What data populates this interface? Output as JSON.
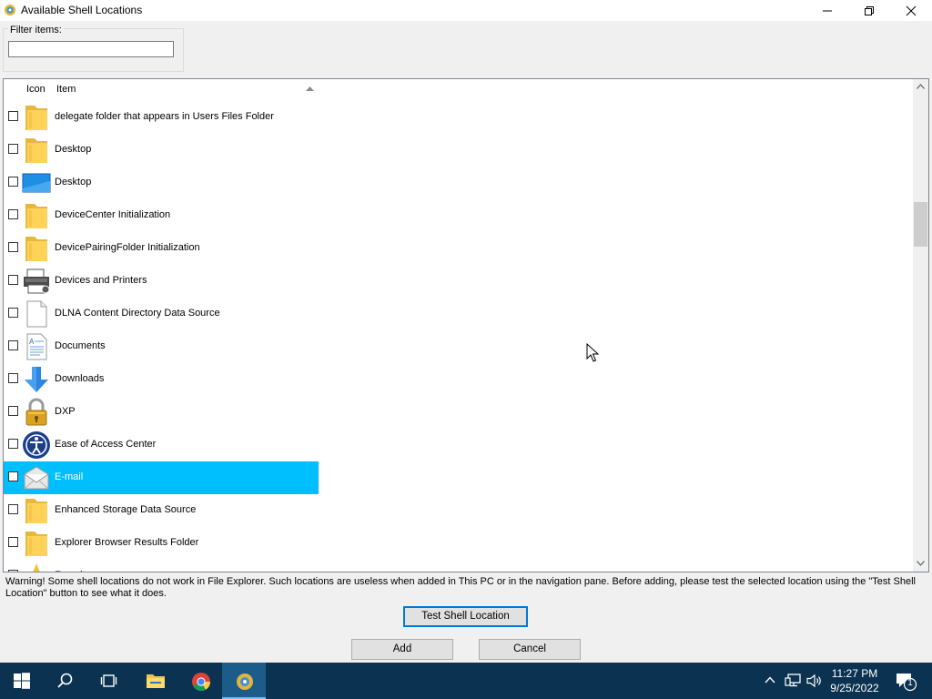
{
  "window": {
    "title": "Available Shell Locations",
    "colors": {
      "selection": "#00bfff",
      "taskbar": "#0b3250",
      "focus_border": "#0078d7"
    }
  },
  "filter": {
    "label": "Filter items:",
    "value": "",
    "placeholder": ""
  },
  "list": {
    "columns": {
      "icon": "Icon",
      "item": "Item"
    },
    "sort": "ascending",
    "items": [
      {
        "label": "delegate folder that appears in Users Files Folder",
        "icon": "folder-icon",
        "checked": false,
        "selected": false
      },
      {
        "label": "Desktop",
        "icon": "folder-icon",
        "checked": false,
        "selected": false
      },
      {
        "label": "Desktop",
        "icon": "desktop-icon",
        "checked": false,
        "selected": false
      },
      {
        "label": "DeviceCenter Initialization",
        "icon": "folder-icon",
        "checked": false,
        "selected": false
      },
      {
        "label": "DevicePairingFolder Initialization",
        "icon": "folder-icon",
        "checked": false,
        "selected": false
      },
      {
        "label": "Devices and Printers",
        "icon": "printer-icon",
        "checked": false,
        "selected": false
      },
      {
        "label": "DLNA Content Directory Data Source",
        "icon": "blank-document-icon",
        "checked": false,
        "selected": false
      },
      {
        "label": "Documents",
        "icon": "documents-icon",
        "checked": false,
        "selected": false
      },
      {
        "label": "Downloads",
        "icon": "download-arrow-icon",
        "checked": false,
        "selected": false
      },
      {
        "label": "DXP",
        "icon": "padlock-icon",
        "checked": false,
        "selected": false
      },
      {
        "label": "Ease of Access Center",
        "icon": "ease-of-access-icon",
        "checked": false,
        "selected": false
      },
      {
        "label": "E-mail",
        "icon": "envelope-icon",
        "checked": false,
        "selected": true
      },
      {
        "label": "Enhanced Storage Data Source",
        "icon": "folder-icon",
        "checked": false,
        "selected": false
      },
      {
        "label": "Explorer Browser Results Folder",
        "icon": "folder-icon",
        "checked": false,
        "selected": false
      },
      {
        "label": "Favorites",
        "icon": "star-icon",
        "checked": false,
        "selected": false
      }
    ]
  },
  "warning": "Warning! Some shell locations do not work in File Explorer. Such locations are useless when added in This PC or in the navigation pane. Before adding, please test the selected location using the \"Test Shell Location\" button to see what it does.",
  "buttons": {
    "test": "Test Shell Location",
    "add": "Add",
    "cancel": "Cancel"
  },
  "taskbar": {
    "apps": [
      "start-icon",
      "search-icon",
      "task-view-icon",
      "file-explorer-icon",
      "chrome-icon",
      "winaero-tweaker-icon"
    ],
    "tray_icons": [
      "chevron-up-icon",
      "network-icon",
      "volume-icon"
    ],
    "clock": {
      "time": "11:27 PM",
      "date": "9/25/2022"
    },
    "notification_count": "1"
  }
}
